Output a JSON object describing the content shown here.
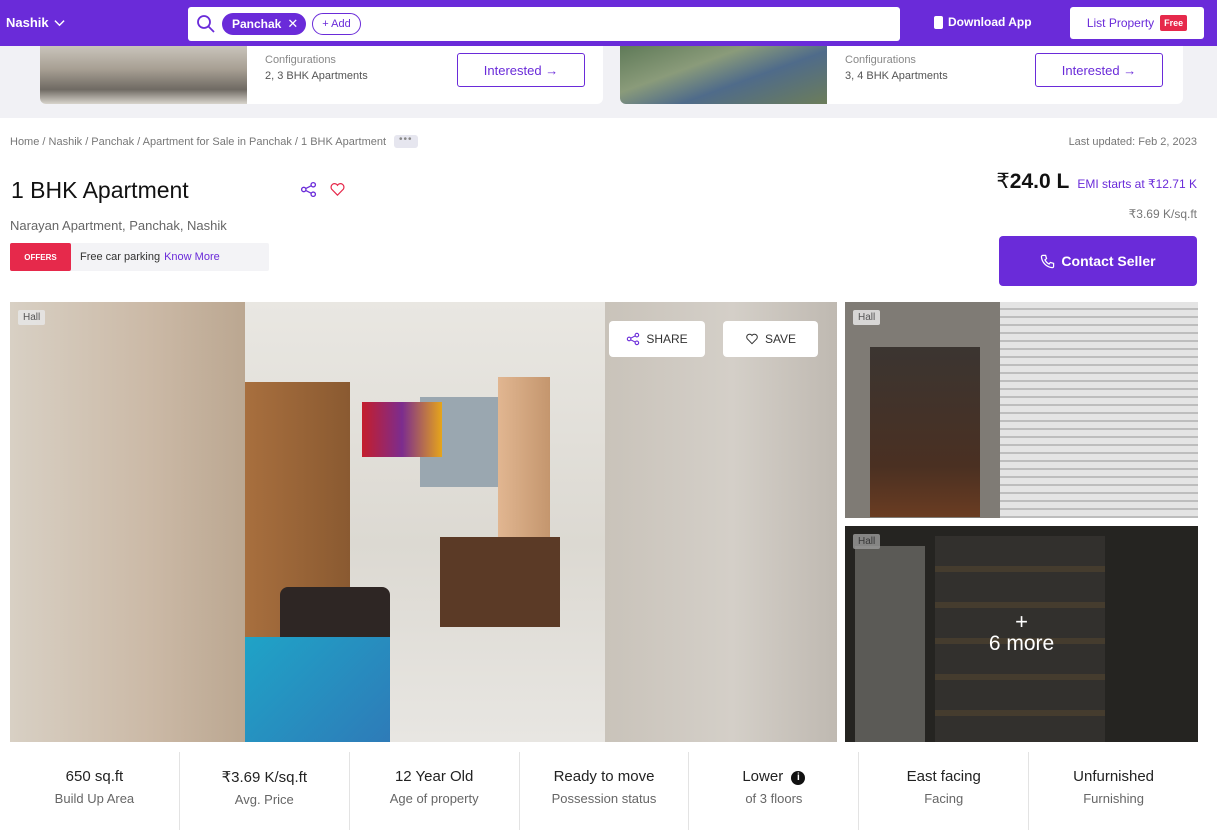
{
  "nav": {
    "city": "Nashik",
    "search_chip": "Panchak",
    "add_label": "+ Add",
    "download_app": "Download App",
    "list_property": "List Property",
    "free_badge": "Free"
  },
  "projects": [
    {
      "config_label": "Configurations",
      "config_value": "2, 3 BHK Apartments",
      "button": "Interested →"
    },
    {
      "config_label": "Configurations",
      "config_value": "3, 4 BHK Apartments",
      "button": "Interested →"
    }
  ],
  "breadcrumb": "Home / Nashik / Panchak / Apartment for Sale in Panchak / 1 BHK Apartment",
  "breadcrumb_more": "•••",
  "last_updated": "Last updated: Feb 2, 2023",
  "listing": {
    "title": "1 BHK Apartment",
    "address": "Narayan Apartment, Panchak, Nashik",
    "offer_tag": "OFFERS",
    "offer_text": "Free car parking",
    "offer_link": "Know More",
    "price_symbol": "₹",
    "price": "24.0 L",
    "emi": "EMI starts at ₹12.71 K",
    "price_per_sqft": "₹3.69 K/sq.ft",
    "contact": "Contact Seller"
  },
  "gallery": {
    "main_label": "Hall",
    "share": "SHARE",
    "save": "SAVE",
    "side1_label": "Hall",
    "side2_label": "Hall",
    "more_plus": "+",
    "more_count": "6 more"
  },
  "stats": [
    {
      "value": "650 sq.ft",
      "label": "Build Up Area"
    },
    {
      "value": "₹3.69 K/sq.ft",
      "label": "Avg. Price"
    },
    {
      "value": "12 Year Old",
      "label": "Age of property"
    },
    {
      "value": "Ready to move",
      "label": "Possession status"
    },
    {
      "value": "Lower",
      "label": "of 3 floors"
    },
    {
      "value": "East facing",
      "label": "Facing"
    },
    {
      "value": "Unfurnished",
      "label": "Furnishing"
    }
  ],
  "colors": {
    "brand": "#6a2bd9",
    "offer": "#e6294b"
  }
}
